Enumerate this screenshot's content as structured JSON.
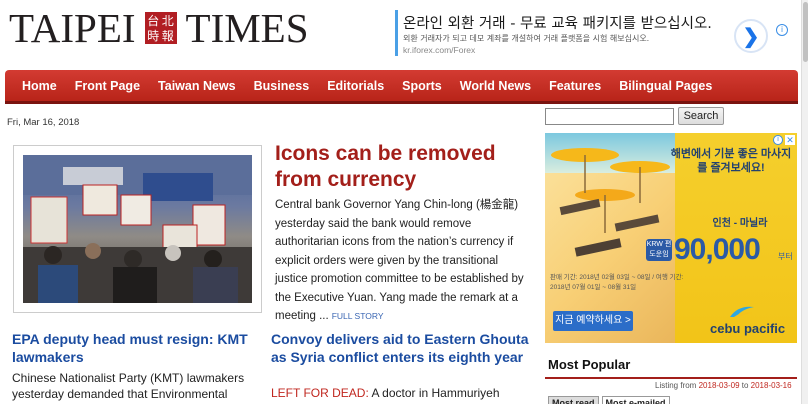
{
  "masthead": {
    "logo_left": "TAIPEI",
    "logo_seal": [
      "台",
      "北",
      "時",
      "報"
    ],
    "logo_right": "TIMES"
  },
  "ad_banner": {
    "title": "온라인 외환 거래 - 무료 교육 패키지를 받으십시오.",
    "description": "외환 거래자가 되고 데모 계좌를 개설하여 거래 플랫폼을 시험 해보십시오.",
    "url": "kr.iforex.com/Forex",
    "arrow_icon": "chevron-right-icon",
    "info_icon": "info-icon"
  },
  "nav": {
    "items": [
      "Home",
      "Front Page",
      "Taiwan News",
      "Business",
      "Editorials",
      "Sports",
      "World News",
      "Features",
      "Bilingual Pages"
    ]
  },
  "date": "Fri, Mar 16, 2018",
  "lead": {
    "title": "Icons can be removed from currency",
    "body": "Central bank Governor Yang Chin-long (楊金龍) yesterday said the bank would remove authoritarian icons from the nation’s currency if explicit orders were given by the transitional justice promotion committee to be established by the Executive Yuan. Yang made the remark at a meeting ...",
    "more": "FULL STORY"
  },
  "story2": {
    "title": "EPA deputy head must resign: KMT lawmakers",
    "body": "Chinese Nationalist Party (KMT) lawmakers yesterday demanded that Environmental"
  },
  "story3": {
    "title": "Convoy delivers aid to Eastern Ghouta as Syria conflict enters its eighth year",
    "kicker": "LEFT FOR DEAD:",
    "body": " A doctor in Hammuriyeh"
  },
  "search": {
    "placeholder": "",
    "button": "Search"
  },
  "side_ad": {
    "headline": "해변에서 기분 좋은 마사지를 즐겨보세요!",
    "route": "인천 - 마닐라",
    "badge": "KRW 편도운임",
    "price": "90,000",
    "unit": "부터",
    "dates": "판매 기간: 2018년 02월 03일 ~ 08일 / 여행 기간: 2018년 07월 01일 ~ 08월 31일",
    "cta": "지금 예약하세요 >",
    "brand": "cebu pacific"
  },
  "most_popular": {
    "title": "Most Popular",
    "listing_prefix": "Listing from",
    "from": "2018-03-09",
    "to_word": "to",
    "to": "2018-03-16",
    "tabs": [
      "Most read",
      "Most e-mailed"
    ]
  },
  "colors": {
    "nav_red": "#c62f26",
    "headline_red": "#a31f1a",
    "link_blue": "#1b4ca0"
  }
}
